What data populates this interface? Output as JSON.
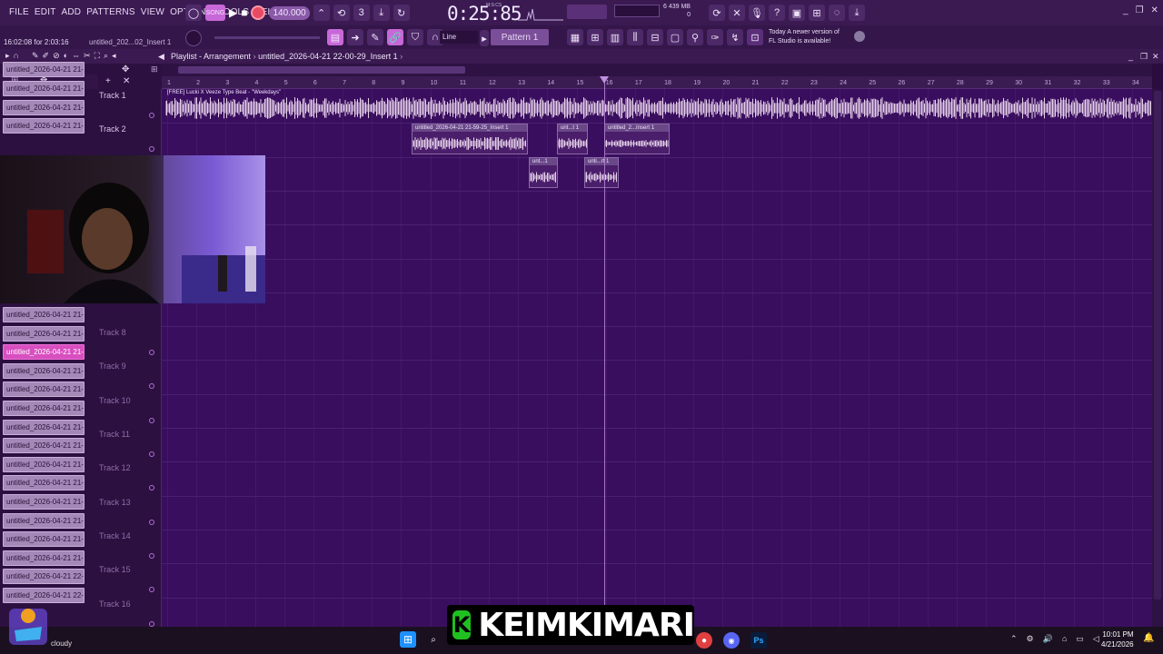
{
  "menus": [
    "FILE",
    "EDIT",
    "ADD",
    "PATTERNS",
    "VIEW",
    "OPTIONS",
    "TOOLS",
    "HELP"
  ],
  "transport": {
    "tempo": "140.000",
    "time": "0:25:85",
    "time_sub": "M:S:CS"
  },
  "cpu": {
    "line1": "6   439 MB",
    "line2": "0"
  },
  "hint": {
    "time": "16:02:08 for 2:03:16",
    "file": "untitled_202...02_Insert 1"
  },
  "snap": "Line",
  "pattern": "Pattern 1",
  "news": {
    "line1": "Today  A newer version of",
    "line2": "FL Studio is available!"
  },
  "playlist": {
    "title": "Playlist - Arrangement",
    "breadcrumb": "untitled_2026-04-21 22-00-29_Insert 1"
  },
  "channels_top": [
    "untitled_2026-04-21 21-...",
    "untitled_2026-04-21 21-...",
    "untitled_2026-04-21 21-...",
    "untitled_2026-04-21 21-..."
  ],
  "channels_bottom": [
    "untitled_2026-04-21 21-...",
    "untitled_2026-04-21 21-...",
    "untitled_2026-04-21 21-...",
    "untitled_2026-04-21 21-...",
    "untitled_2026-04-21 21-...",
    "untitled_2026-04-21 21-...",
    "untitled_2026-04-21 21-...",
    "untitled_2026-04-21 21-...",
    "untitled_2026-04-21 21-...",
    "untitled_2026-04-21 21-...",
    "untitled_2026-04-21 21-...",
    "untitled_2026-04-21 21-...",
    "untitled_2026-04-21 21-...",
    "untitled_2026-04-21 21-...",
    "untitled_2026-04-21 22-...",
    "untitled_2026-04-21 22-..."
  ],
  "tracks": [
    "Track 1",
    "Track 2",
    "Track 8",
    "Track 9",
    "Track 10",
    "Track 11",
    "Track 12",
    "Track 13",
    "Track 14",
    "Track 15",
    "Track 16"
  ],
  "ruler": [
    "1",
    "2",
    "3",
    "4",
    "5",
    "6",
    "7",
    "8",
    "9",
    "10",
    "11",
    "12",
    "13",
    "14",
    "15",
    "16",
    "17",
    "18",
    "19",
    "20",
    "21",
    "22",
    "23",
    "24",
    "25",
    "26",
    "27",
    "28",
    "29",
    "30",
    "31",
    "32",
    "33",
    "34"
  ],
  "clips": {
    "beat": "[FREE] Lucki X Veeze Type Beat - \"Weekdays\"",
    "c1": "untitled_2026-04-21 21-59-25_Insert 1",
    "c2": "unt...t 1",
    "c3": "untitled_2...Insert 1",
    "c4": "unt...1",
    "c5": "unti...rt 1"
  },
  "watermark": {
    "letter": "K",
    "text": "KEIMKIMARI"
  },
  "taskbar": {
    "weather": "cloudy",
    "time": "10:01 PM",
    "date": "4/21/2026"
  },
  "colors": {
    "accent": "#d84fc0",
    "playlist_bg": "#3a0e5e",
    "waveform": "#e6d2ea"
  }
}
